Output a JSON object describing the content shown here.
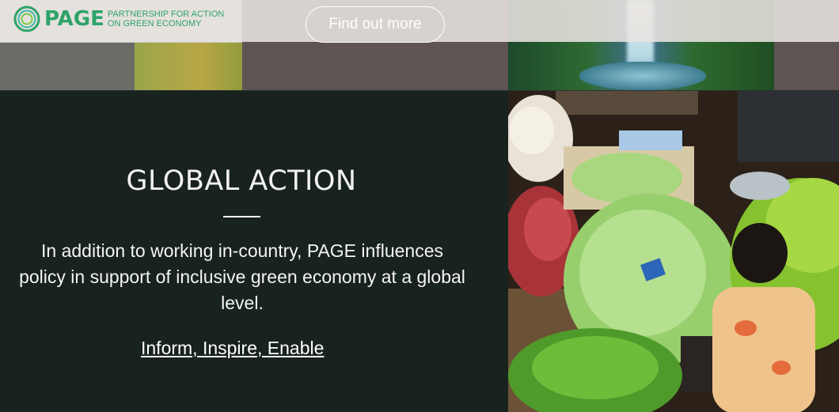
{
  "header": {
    "logo_word": "PAGE",
    "logo_tagline_line1": "PARTNERSHIP FOR ACTION",
    "logo_tagline_line2": "ON GREEN ECONOMY",
    "find_out_more_label": "Find out more"
  },
  "section": {
    "title": "GLOBAL ACTION",
    "body": "In addition to working in-country, PAGE influences policy in support of inclusive green economy at a global level.",
    "link_label": "Inform, Inspire, Enable "
  },
  "colors": {
    "brand_green": "#2ea36a",
    "panel_bg": "#18221f",
    "topbar_bg": "#e8e4e0"
  },
  "icons": {
    "logo": "page-logo-ring-icon"
  }
}
